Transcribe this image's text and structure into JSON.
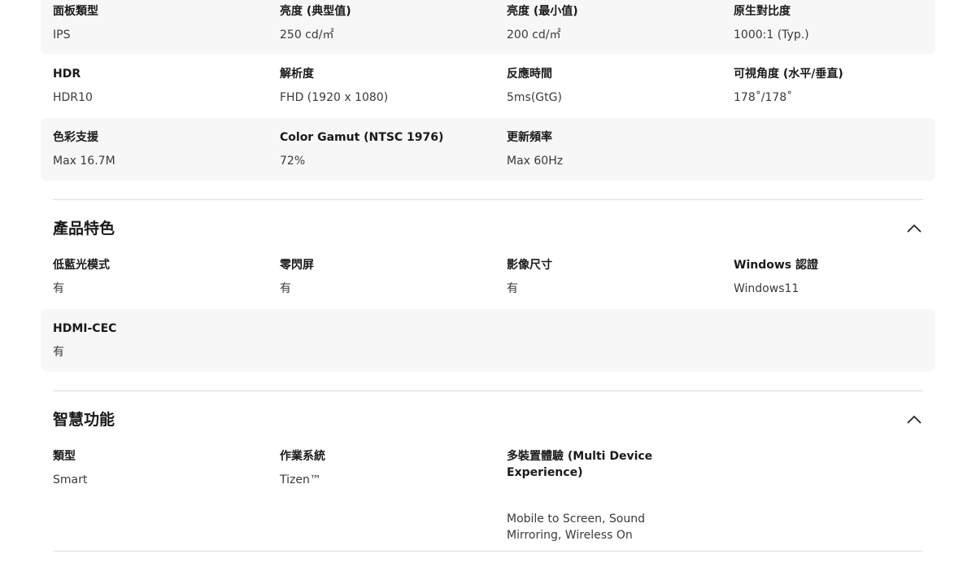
{
  "display_section": {
    "rows": [
      [
        {
          "label": "面板類型",
          "value": "IPS"
        },
        {
          "label": "亮度 (典型值)",
          "value": "250 cd/㎡"
        },
        {
          "label": "亮度 (最小值)",
          "value": "200 cd/㎡"
        },
        {
          "label": "原生對比度",
          "value": "1000:1 (Typ.)"
        }
      ],
      [
        {
          "label": "HDR",
          "value": "HDR10"
        },
        {
          "label": "解析度",
          "value": "FHD (1920 x 1080)"
        },
        {
          "label": "反應時間",
          "value": "5ms(GtG)"
        },
        {
          "label": "可視角度 (水平/垂直)",
          "value": "178˚/178˚"
        }
      ],
      [
        {
          "label": "色彩支援",
          "value": "Max 16.7M"
        },
        {
          "label": "Color Gamut (NTSC 1976)",
          "value": "72%"
        },
        {
          "label": "更新頻率",
          "value": "Max 60Hz"
        }
      ]
    ]
  },
  "features_section": {
    "title": "產品特色",
    "toggle_icon": "chevron-up-icon",
    "rows": [
      [
        {
          "label": "低藍光模式",
          "value": "有"
        },
        {
          "label": "零閃屏",
          "value": "有"
        },
        {
          "label": "影像尺寸",
          "value": "有"
        },
        {
          "label": "Windows 認證",
          "value": "Windows11"
        }
      ],
      [
        {
          "label": "HDMI-CEC",
          "value": "有"
        }
      ]
    ]
  },
  "smart_section": {
    "title": "智慧功能",
    "toggle_icon": "chevron-up-icon",
    "rows": [
      [
        {
          "label": "類型",
          "value": "Smart"
        },
        {
          "label": "作業系統",
          "value": "Tizen™"
        },
        {
          "label": "多裝置體驗 (Multi Device Experience)",
          "value": "Mobile to Screen, Sound Mirroring, Wireless On"
        }
      ]
    ]
  }
}
